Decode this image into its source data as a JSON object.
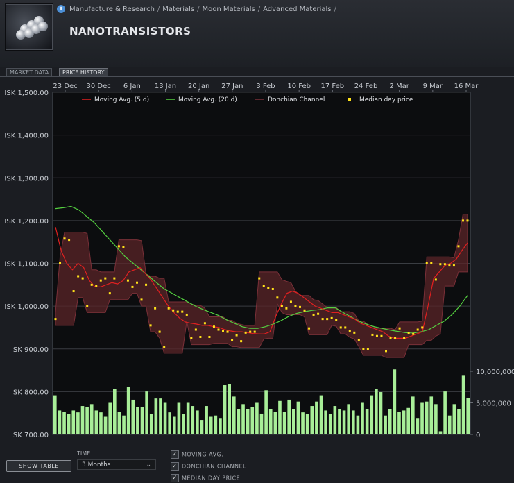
{
  "breadcrumb": [
    "Manufacture & Research",
    "Materials",
    "Moon Materials",
    "Advanced Materials"
  ],
  "item": {
    "title": "NANOTRANSISTORS",
    "icon": "nanotransistors-item-icon"
  },
  "tabs": [
    {
      "label": "MARKET DATA",
      "active": false
    },
    {
      "label": "PRICE HISTORY",
      "active": true
    }
  ],
  "chart_data": {
    "type": "line",
    "x_tick_labels": [
      "23 Dec",
      "30 Dec",
      "6 Jan",
      "13 Jan",
      "20 Jan",
      "27 Jan",
      "3 Feb",
      "10 Feb",
      "17 Feb",
      "24 Feb",
      "2 Mar",
      "9 Mar",
      "16 Mar"
    ],
    "y_tick_labels": [
      "ISK 1,500.00",
      "ISK 1,400.00",
      "ISK 1,300.00",
      "ISK 1,200.00",
      "ISK 1,100.00",
      "ISK 1,000.00",
      "ISK 900.00",
      "ISK 800.00",
      "ISK 700.00"
    ],
    "ylim": [
      700,
      1500
    ],
    "volume_tick_labels": [
      "10,000,000",
      "5,000,000",
      "0"
    ],
    "volume_ylim": [
      0,
      10000000
    ],
    "legend": [
      "Moving Avg. (5 d)",
      "Moving Avg. (20 d)",
      "Donchian Channel",
      "Median day price"
    ],
    "legend_position": "top",
    "grid": true,
    "colors": {
      "ma5": "#e02020",
      "ma20": "#55d040",
      "donchian": "#5a2428",
      "median": "#ffe21a",
      "volume": "#a8ee98"
    },
    "series": [
      {
        "name": "Median day price",
        "values": [
          970,
          1100,
          1158,
          1155,
          1035,
          1070,
          1065,
          1000,
          1050,
          1048,
          1060,
          1065,
          1030,
          1065,
          1140,
          1138,
          1060,
          1045,
          1055,
          1015,
          1050,
          955,
          995,
          940,
          905,
          995,
          990,
          987,
          987,
          980,
          925,
          945,
          928,
          960,
          928,
          952,
          945,
          942,
          940,
          920,
          932,
          918,
          938,
          940,
          940,
          1065,
          1047,
          1043,
          1040,
          1020,
          1000,
          995,
          1010,
          1000,
          998,
          990,
          948,
          980,
          982,
          970,
          970,
          972,
          968,
          950,
          950,
          942,
          938,
          920,
          900,
          900,
          933,
          930,
          930,
          895,
          925,
          925,
          948,
          925,
          937,
          935,
          945,
          950,
          1100,
          1100,
          1062,
          1098,
          1098,
          1095,
          1095,
          1140,
          1200,
          1200
        ]
      },
      {
        "name": "Moving Avg. (5 d)",
        "values": [
          1185,
          1130,
          1100,
          1085,
          1100,
          1090,
          1060,
          1045,
          1045,
          1050,
          1055,
          1052,
          1060,
          1080,
          1085,
          1090,
          1075,
          1060,
          1040,
          1020,
          1000,
          985,
          972,
          963,
          960,
          958,
          955,
          955,
          952,
          950,
          945,
          942,
          940,
          940,
          938,
          936,
          935,
          935,
          940,
          975,
          1005,
          1030,
          1035,
          1030,
          1020,
          1010,
          1000,
          995,
          990,
          985,
          985,
          980,
          975,
          970,
          960,
          955,
          950,
          945,
          940,
          930,
          925,
          925,
          925,
          930,
          935,
          940,
          1000,
          1065,
          1080,
          1095,
          1100,
          1110,
          1130,
          1148
        ]
      },
      {
        "name": "Moving Avg. (20 d)",
        "values": [
          1228,
          1230,
          1233,
          1225,
          1210,
          1195,
          1175,
          1155,
          1135,
          1115,
          1100,
          1085,
          1070,
          1055,
          1040,
          1030,
          1020,
          1010,
          1000,
          992,
          985,
          978,
          968,
          960,
          952,
          948,
          948,
          952,
          958,
          966,
          976,
          983,
          987,
          990,
          992,
          996,
          996,
          985,
          975,
          965,
          958,
          952,
          948,
          944,
          941,
          938,
          937,
          940,
          945,
          955,
          965,
          980,
          1000,
          1025
        ]
      }
    ],
    "volume_millions": [
      6.2,
      3.8,
      3.6,
      3.2,
      3.8,
      3.5,
      4.5,
      4.3,
      4.8,
      3.8,
      3.5,
      2.8,
      5.0,
      7.2,
      3.6,
      3.0,
      7.5,
      5.5,
      4.3,
      4.3,
      6.8,
      3.2,
      5.7,
      5.7,
      5.0,
      3.5,
      2.8,
      5.0,
      3.2,
      5.0,
      4.5,
      3.8,
      2.3,
      4.5,
      2.8,
      3.0,
      2.5,
      7.8,
      8.0,
      6.0,
      4.0,
      4.8,
      4.0,
      4.3,
      5.0,
      3.3,
      7.0,
      4.0,
      3.6,
      5.3,
      3.6,
      5.5,
      4.0,
      5.2,
      3.5,
      3.2,
      4.5,
      5.2,
      6.2,
      3.8,
      3.2,
      4.5,
      4.0,
      3.8,
      4.8,
      3.8,
      3.0,
      5.0,
      4.0,
      6.2,
      7.2,
      6.7,
      3.0,
      4.0,
      10.3,
      3.6,
      3.8,
      4.2,
      6.0,
      2.5,
      5.0,
      5.2,
      6.0,
      4.8,
      0.5,
      6.8,
      3.0,
      4.8,
      4.0,
      9.3,
      5.8
    ]
  },
  "controls": {
    "show_table": "SHOW TABLE",
    "time_label": "TIME",
    "time_value": "3 Months",
    "checkboxes": [
      "MOVING AVG.",
      "DONCHIAN CHANNEL",
      "MEDIAN DAY PRICE"
    ]
  }
}
